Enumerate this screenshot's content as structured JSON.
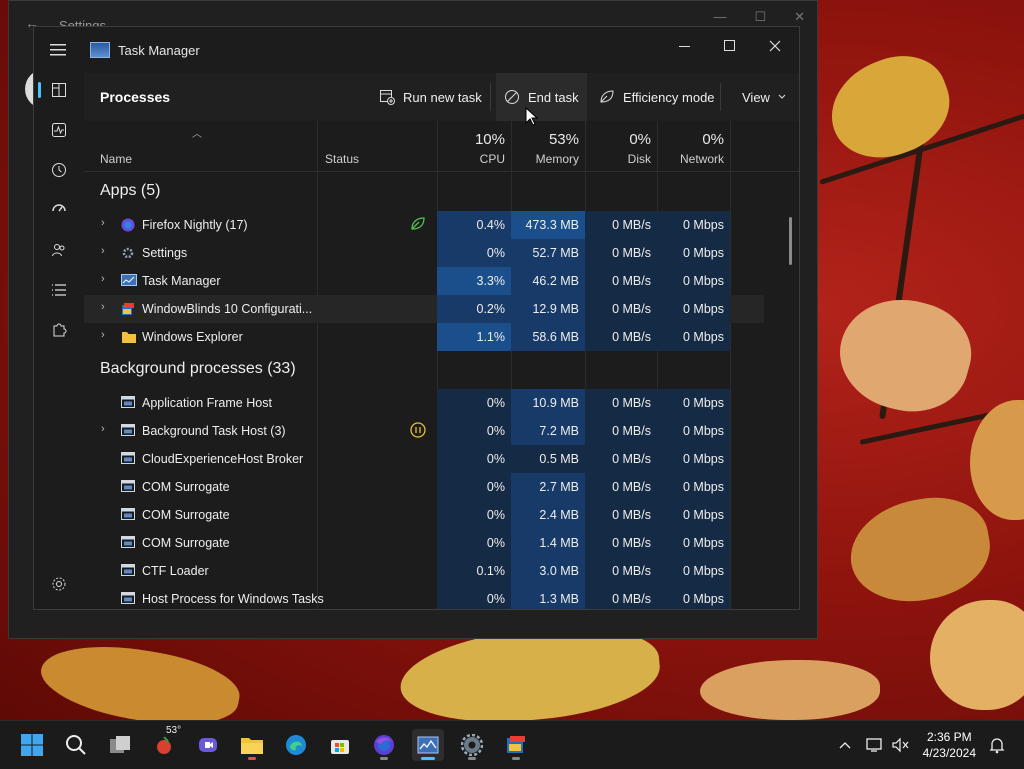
{
  "settings_window": {
    "title": "Settings"
  },
  "task_manager": {
    "title": "Task Manager",
    "page_title": "Processes",
    "commands": {
      "run_new_task": "Run new task",
      "end_task": "End task",
      "efficiency_mode": "Efficiency mode",
      "view": "View"
    },
    "columns": {
      "name": "Name",
      "status": "Status",
      "cpu": {
        "pct": "10%",
        "label": "CPU"
      },
      "memory": {
        "pct": "53%",
        "label": "Memory"
      },
      "disk": {
        "pct": "0%",
        "label": "Disk"
      },
      "network": {
        "pct": "0%",
        "label": "Network"
      }
    },
    "apps_group": "Apps (5)",
    "apps": [
      {
        "name": "Firefox Nightly (17)",
        "cpu": "0.4%",
        "memory": "473.3 MB",
        "disk": "0 MB/s",
        "network": "0 Mbps"
      },
      {
        "name": "Settings",
        "cpu": "0%",
        "memory": "52.7 MB",
        "disk": "0 MB/s",
        "network": "0 Mbps"
      },
      {
        "name": "Task Manager",
        "cpu": "3.3%",
        "memory": "46.2 MB",
        "disk": "0 MB/s",
        "network": "0 Mbps"
      },
      {
        "name": "WindowBlinds 10 Configurati...",
        "cpu": "0.2%",
        "memory": "12.9 MB",
        "disk": "0 MB/s",
        "network": "0 Mbps"
      },
      {
        "name": "Windows Explorer",
        "cpu": "1.1%",
        "memory": "58.6 MB",
        "disk": "0 MB/s",
        "network": "0 Mbps"
      }
    ],
    "bg_group": "Background processes (33)",
    "background": [
      {
        "name": "Application Frame Host",
        "cpu": "0%",
        "memory": "10.9 MB",
        "disk": "0 MB/s",
        "network": "0 Mbps"
      },
      {
        "name": "Background Task Host (3)",
        "cpu": "0%",
        "memory": "7.2 MB",
        "disk": "0 MB/s",
        "network": "0 Mbps"
      },
      {
        "name": "CloudExperienceHost Broker",
        "cpu": "0%",
        "memory": "0.5 MB",
        "disk": "0 MB/s",
        "network": "0 Mbps"
      },
      {
        "name": "COM Surrogate",
        "cpu": "0%",
        "memory": "2.7 MB",
        "disk": "0 MB/s",
        "network": "0 Mbps"
      },
      {
        "name": "COM Surrogate",
        "cpu": "0%",
        "memory": "2.4 MB",
        "disk": "0 MB/s",
        "network": "0 Mbps"
      },
      {
        "name": "COM Surrogate",
        "cpu": "0%",
        "memory": "1.4 MB",
        "disk": "0 MB/s",
        "network": "0 Mbps"
      },
      {
        "name": "CTF Loader",
        "cpu": "0.1%",
        "memory": "3.0 MB",
        "disk": "0 MB/s",
        "network": "0 Mbps"
      },
      {
        "name": "Host Process for Windows Tasks",
        "cpu": "0%",
        "memory": "1.3 MB",
        "disk": "0 MB/s",
        "network": "0 Mbps"
      }
    ]
  },
  "taskbar": {
    "weather_temp": "53°",
    "time": "2:36 PM",
    "date": "4/23/2024"
  },
  "colors": {
    "accent": "#4cc2ff",
    "heat_low": "#152a44",
    "heat_mid": "#173a68",
    "heat_high": "#1a4f8c"
  }
}
